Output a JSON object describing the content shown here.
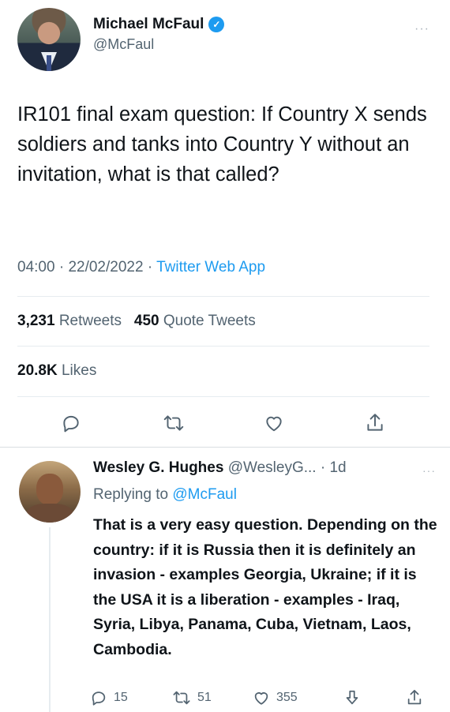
{
  "tweet": {
    "author_name": "Michael McFaul",
    "verified_icon": "verified-badge-icon",
    "handle": "@McFaul",
    "text": "IR101 final exam question: If Country X sends soldiers and tanks into Country Y without an invitation, what is that called?",
    "time": "04:00",
    "date": "22/02/2022",
    "source": "Twitter Web App",
    "separator": "·",
    "retweets_count": "3,231",
    "retweets_label": "Retweets",
    "quotes_count": "450",
    "quotes_label": "Quote Tweets",
    "likes_count": "20.8K",
    "likes_label": "Likes",
    "more_icon": "more-dots-icon"
  },
  "actions": {
    "icons": [
      "reply-icon",
      "retweet-icon",
      "like-icon",
      "share-icon"
    ]
  },
  "reply": {
    "author_name": "Wesley G. Hughes",
    "handle": "@WesleyG...",
    "age": "· 1d",
    "replying_prefix": "Replying to",
    "replying_mention": "@McFaul",
    "text": "That is a very easy question. Depending on the country: if it is Russia then it is definitely an invasion - examples Georgia, Ukraine; if it is the USA it is a liberation - examples - Iraq, Syria, Libya, Panama, Cuba, Vietnam, Laos, Cambodia.",
    "reply_count": "15",
    "retweet_count": "51",
    "like_count": "355"
  },
  "colors": {
    "accent": "#1d9bf0",
    "text": "#0f1419",
    "muted": "#536471",
    "divider": "#e6ecf0"
  }
}
